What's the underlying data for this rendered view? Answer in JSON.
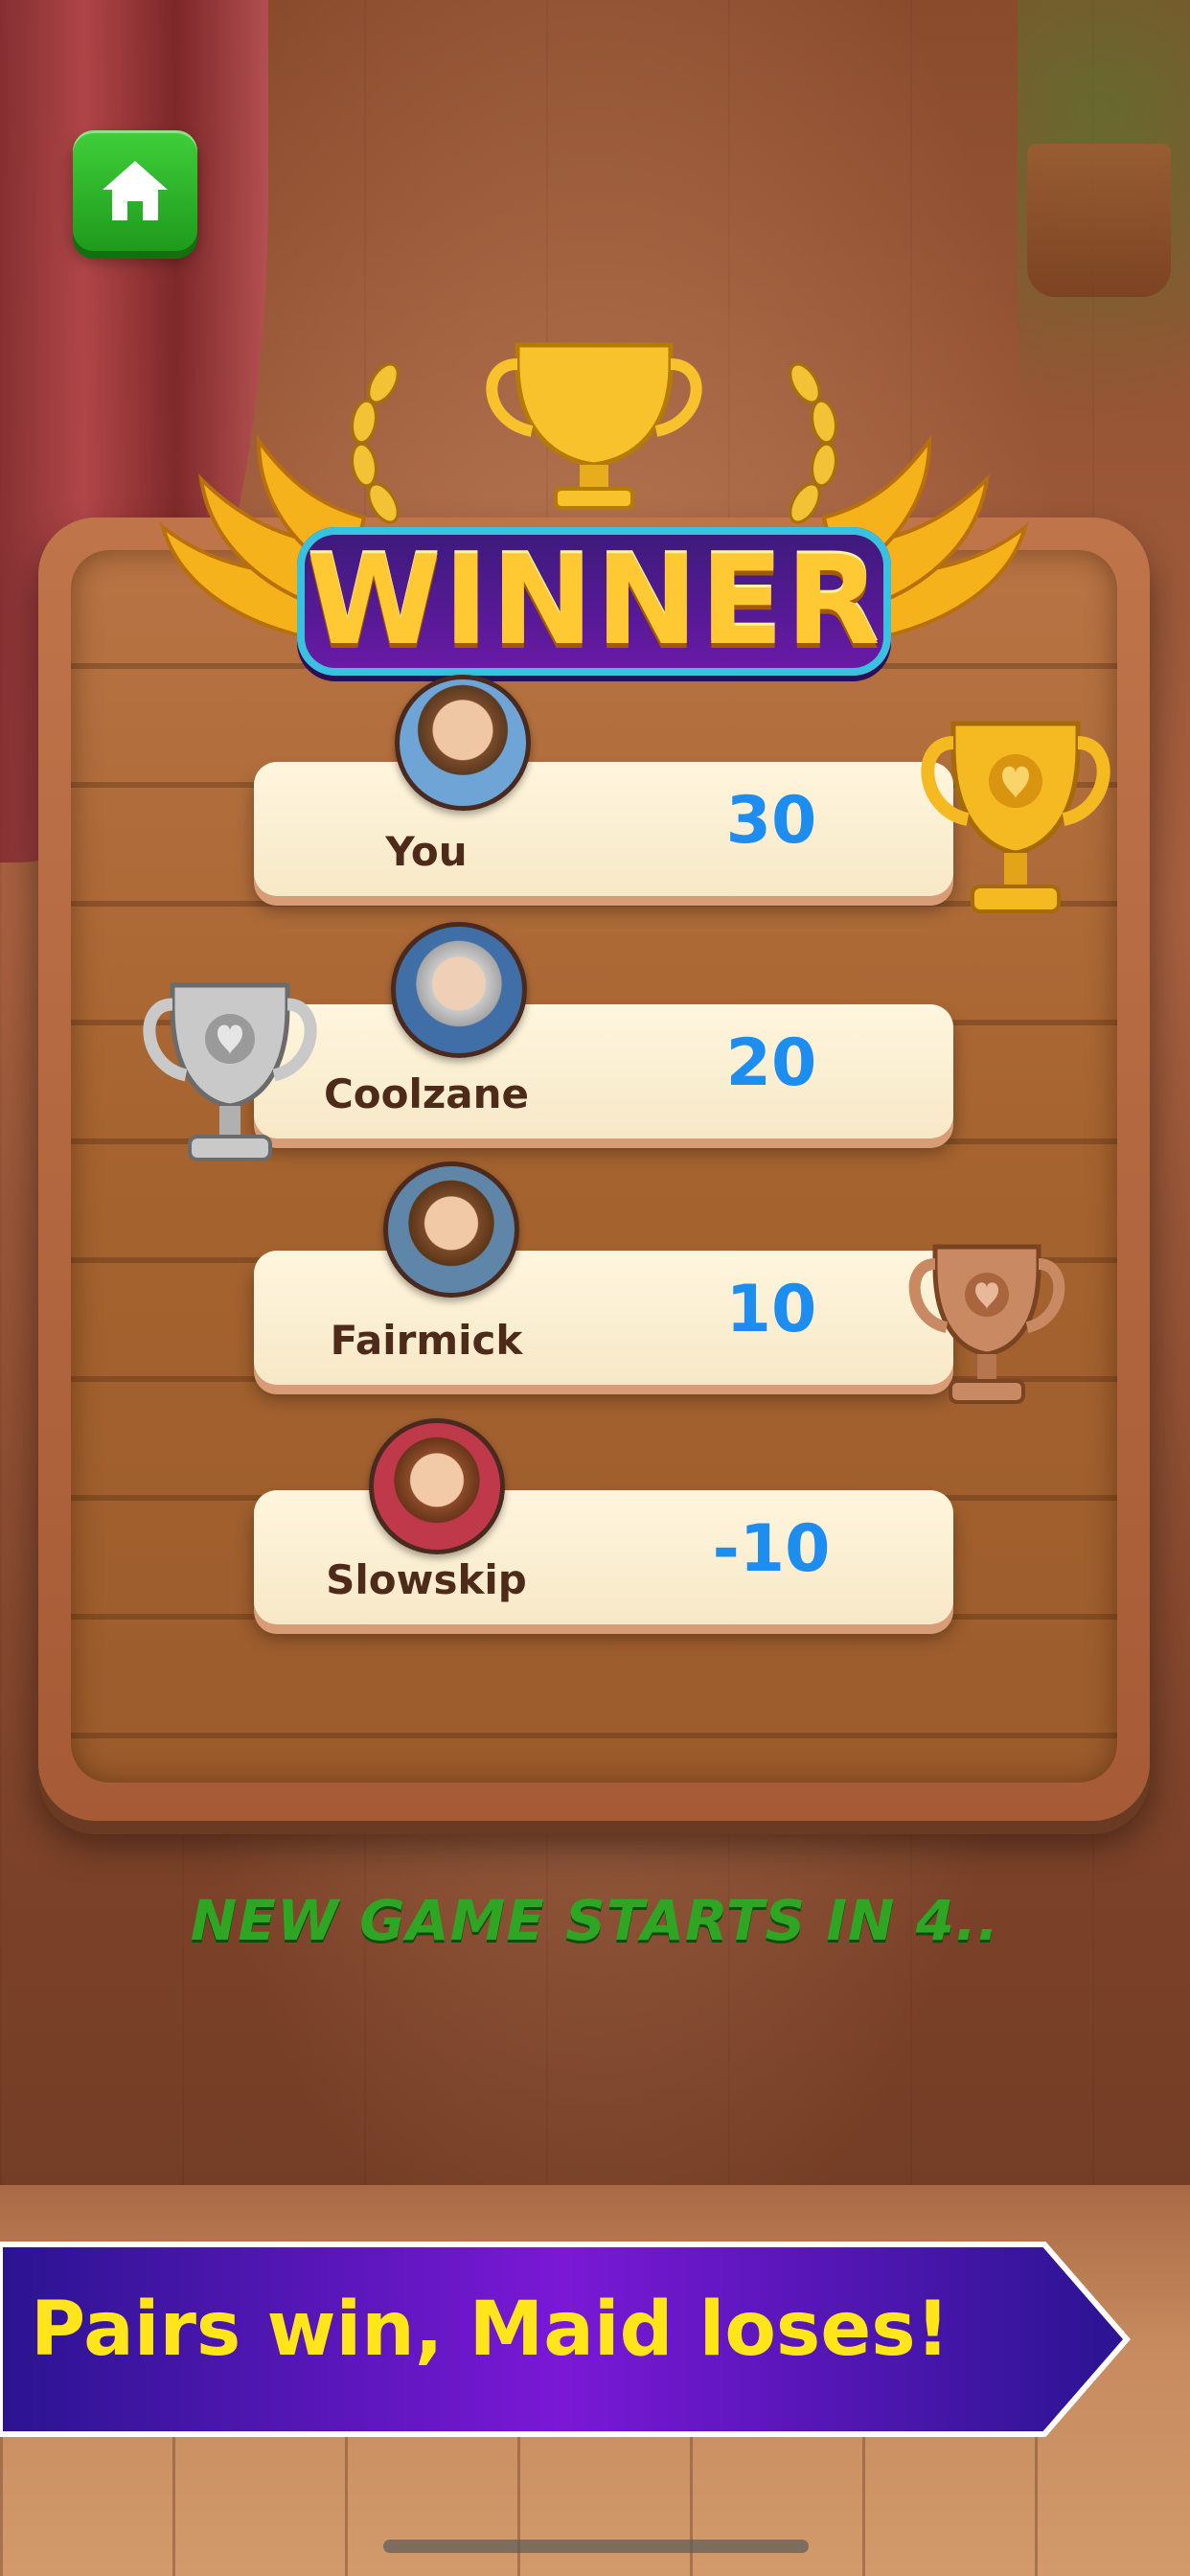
{
  "home_button": {
    "icon": "home-icon"
  },
  "winner": {
    "title": "WINNER"
  },
  "players": [
    {
      "name": "You",
      "score": "30",
      "trophy": "gold"
    },
    {
      "name": "Coolzane",
      "score": "20",
      "trophy": "silver"
    },
    {
      "name": "Fairmick",
      "score": "10",
      "trophy": "bronze"
    },
    {
      "name": "Slowskip",
      "score": "-10",
      "trophy": "none"
    }
  ],
  "countdown": "NEW GAME STARTS IN 4..",
  "banner": {
    "text": "Pairs win, Maid loses!"
  },
  "colors": {
    "score": "#1d8df0",
    "name": "#4d2a1a",
    "countdown": "#2ea523",
    "banner_text": "#ffe51a",
    "banner_bg_start": "#2a1491",
    "banner_bg_mid": "#7a18d6",
    "gold": "#f5b921",
    "silver": "#c9c9c9",
    "bronze": "#c98a63"
  }
}
